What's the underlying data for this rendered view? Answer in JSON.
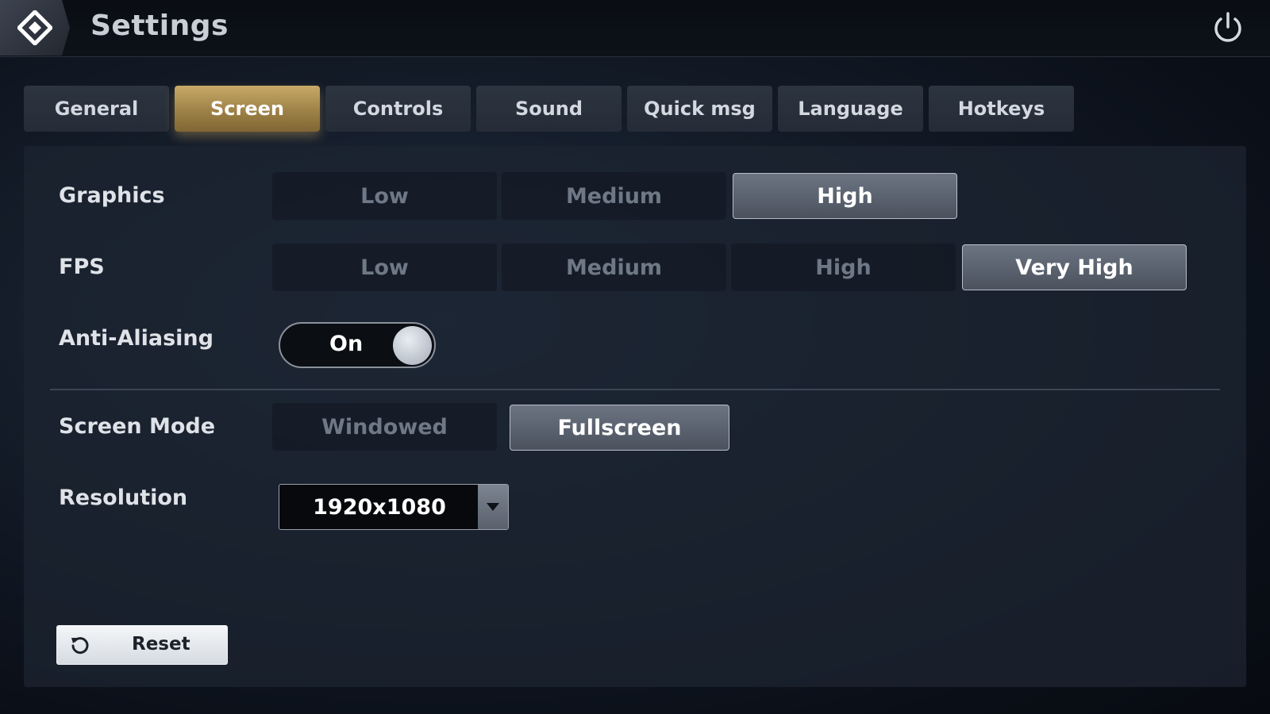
{
  "header": {
    "title": "Settings"
  },
  "tabs": [
    {
      "label": "General",
      "active": false
    },
    {
      "label": "Screen",
      "active": true
    },
    {
      "label": "Controls",
      "active": false
    },
    {
      "label": "Sound",
      "active": false
    },
    {
      "label": "Quick msg",
      "active": false
    },
    {
      "label": "Language",
      "active": false
    },
    {
      "label": "Hotkeys",
      "active": false
    }
  ],
  "graphics": {
    "label": "Graphics",
    "options": [
      "Low",
      "Medium",
      "High"
    ],
    "selected": "High"
  },
  "fps": {
    "label": "FPS",
    "options": [
      "Low",
      "Medium",
      "High",
      "Very High"
    ],
    "selected": "Very High"
  },
  "anti_aliasing": {
    "label": "Anti-Aliasing",
    "state": "On"
  },
  "screen_mode": {
    "label": "Screen Mode",
    "options": [
      "Windowed",
      "Fullscreen"
    ],
    "selected": "Fullscreen"
  },
  "resolution": {
    "label": "Resolution",
    "value": "1920x1080"
  },
  "reset": {
    "label": "Reset"
  },
  "icons": {
    "logo": "diamond-logo-icon",
    "power": "power-icon",
    "dropdown": "triangle-down-icon",
    "reset": "refresh-icon"
  },
  "colors": {
    "active_tab": "#b39555",
    "selected_option": "#5d6470",
    "panel": "#1c2431"
  }
}
